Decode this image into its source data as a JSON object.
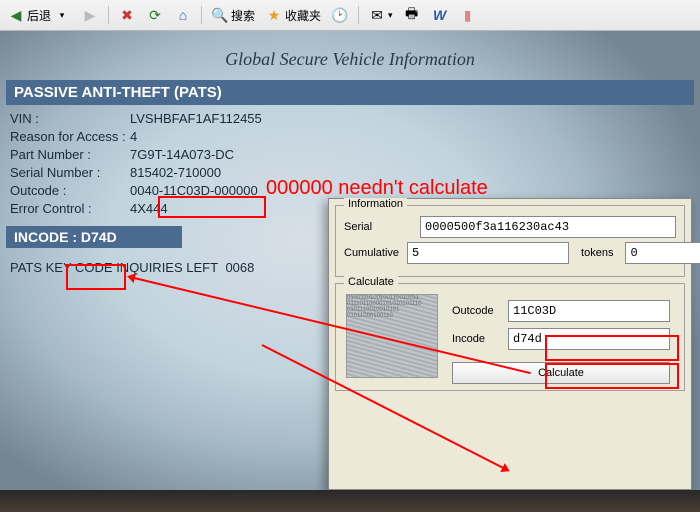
{
  "toolbar": {
    "back": "后退",
    "search": "搜索",
    "favorites": "收藏夹"
  },
  "page": {
    "title": "Global Secure Vehicle Information",
    "section": "PASSIVE ANTI-THEFT (PATS)",
    "incode_label": "INCODE :",
    "incode_value": "D74D",
    "inquiries_label": "PATS KEY CODE INQUIRIES LEFT",
    "inquiries_value": "0068"
  },
  "fields": [
    {
      "label": "VIN :",
      "value": "LVSHBFAF1AF112455"
    },
    {
      "label": "Reason for Access :",
      "value": "4"
    },
    {
      "label": "Part Number :",
      "value": "7G9T-14A073-DC"
    },
    {
      "label": "Serial Number :",
      "value": "815402-710000"
    },
    {
      "label": "Outcode :",
      "value": "0040-11C03D-000000"
    },
    {
      "label": "Error Control :",
      "value": "4X444"
    }
  ],
  "annotation": {
    "text": "000000 needn't calculate"
  },
  "calc": {
    "info_title": "Information",
    "serial_label": "Serial",
    "serial_value": "0000500f3a116230ac43",
    "cumulative_label": "Cumulative",
    "cumulative_value": "5",
    "tokens_label": "tokens",
    "tokens_value": "0",
    "calc_title": "Calculate",
    "outcode_label": "Outcode",
    "outcode_value": "11C03D",
    "incode_label": "Incode",
    "incode_value": "d74d",
    "button": "Calculate"
  }
}
